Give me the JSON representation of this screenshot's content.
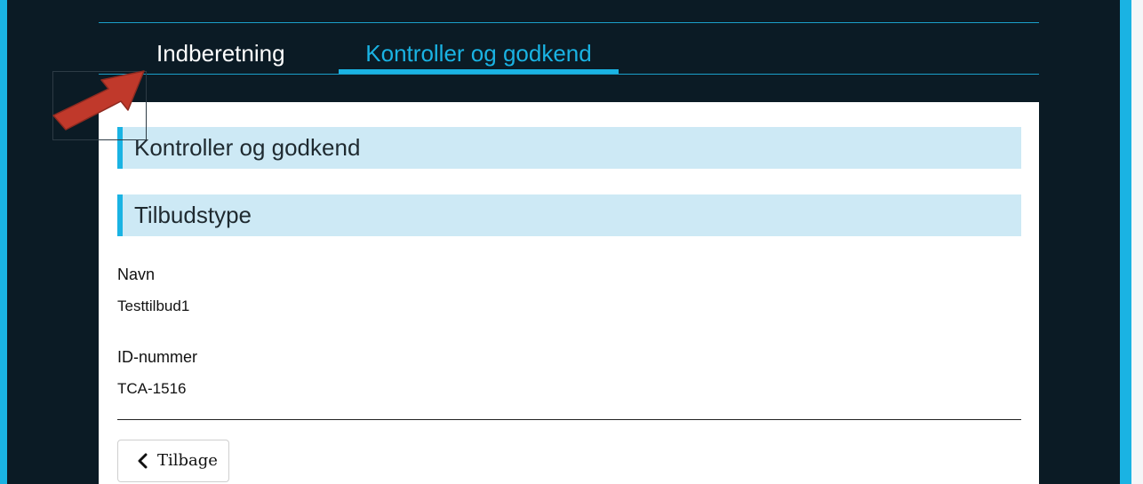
{
  "tabs": [
    {
      "label": "Indberetning",
      "active": false
    },
    {
      "label": "Kontroller og godkend",
      "active": true
    }
  ],
  "sections": {
    "main_title": "Kontroller og godkend",
    "offer_type_title": "Tilbudstype"
  },
  "fields": {
    "name": {
      "label": "Navn",
      "value": "Testtilbud1"
    },
    "id": {
      "label": "ID-nummer",
      "value": "TCA-1516"
    }
  },
  "actions": {
    "back_label": "Tilbage"
  },
  "icons": {
    "annotation_arrow": "arrow-pointer-icon",
    "back": "chevron-left-icon"
  },
  "colors": {
    "accent": "#1ab3e3",
    "dark_background": "#0b1b25",
    "section_header_bg": "#cde9f5",
    "arrow": "#c0392b"
  }
}
